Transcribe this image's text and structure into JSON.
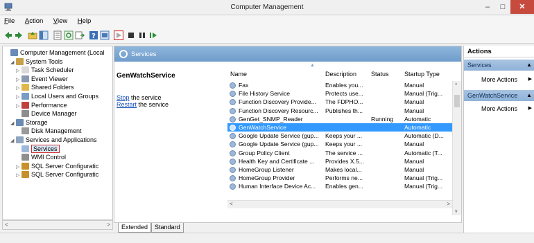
{
  "window": {
    "title": "Computer Management",
    "min": "–",
    "max": "□",
    "close": "✕"
  },
  "menu": [
    "File",
    "Action",
    "View",
    "Help"
  ],
  "tree": {
    "items": [
      {
        "label": "Computer Management (Local",
        "depth": 0,
        "arrow": "",
        "icon": "#6a8bb5"
      },
      {
        "label": "System Tools",
        "depth": 1,
        "arrow": "◢",
        "icon": "#c8a04a"
      },
      {
        "label": "Task Scheduler",
        "depth": 2,
        "arrow": "▷",
        "icon": "#d9d9d9"
      },
      {
        "label": "Event Viewer",
        "depth": 2,
        "arrow": "▷",
        "icon": "#8a9bb0"
      },
      {
        "label": "Shared Folders",
        "depth": 2,
        "arrow": "▷",
        "icon": "#e0b84a"
      },
      {
        "label": "Local Users and Groups",
        "depth": 2,
        "arrow": "▷",
        "icon": "#7a9cc4"
      },
      {
        "label": "Performance",
        "depth": 2,
        "arrow": "▷",
        "icon": "#c04040"
      },
      {
        "label": "Device Manager",
        "depth": 2,
        "arrow": "",
        "icon": "#8e8e8e"
      },
      {
        "label": "Storage",
        "depth": 1,
        "arrow": "◢",
        "icon": "#6a8bb5"
      },
      {
        "label": "Disk Management",
        "depth": 2,
        "arrow": "",
        "icon": "#9a9a9a"
      },
      {
        "label": "Services and Applications",
        "depth": 1,
        "arrow": "◢",
        "icon": "#8fa6c0"
      },
      {
        "label": "Services",
        "depth": 2,
        "arrow": "",
        "icon": "#9cb9d9",
        "highlight": true
      },
      {
        "label": "WMI Control",
        "depth": 2,
        "arrow": "",
        "icon": "#8e8e8e"
      },
      {
        "label": "SQL Server Configuratic",
        "depth": 2,
        "arrow": "▷",
        "icon": "#c8902a"
      },
      {
        "label": "SQL Server Configuratic",
        "depth": 2,
        "arrow": "▷",
        "icon": "#c8902a"
      }
    ]
  },
  "center": {
    "header": "Services",
    "selected_service": "GenWatchService",
    "stop_link": "Stop",
    "stop_rest": " the service",
    "restart_link": "Restart",
    "restart_rest": " the service",
    "columns": [
      "Name",
      "Description",
      "Status",
      "Startup Type"
    ],
    "rows": [
      {
        "name": "Fax",
        "desc": "Enables you...",
        "status": "",
        "type": "Manual"
      },
      {
        "name": "File History Service",
        "desc": "Protects use...",
        "status": "",
        "type": "Manual (Trig..."
      },
      {
        "name": "Function Discovery Provide...",
        "desc": "The FDPHO...",
        "status": "",
        "type": "Manual"
      },
      {
        "name": "Function Discovery Resourc...",
        "desc": "Publishes th...",
        "status": "",
        "type": "Manual"
      },
      {
        "name": "GenGet_SNMP_Reader",
        "desc": "",
        "status": "Running",
        "type": "Automatic"
      },
      {
        "name": "GenWatchService",
        "desc": "",
        "status": "",
        "type": "Automatic",
        "selected": true
      },
      {
        "name": "Google Update Service (gup...",
        "desc": "Keeps your ...",
        "status": "",
        "type": "Automatic (D..."
      },
      {
        "name": "Google Update Service (gup...",
        "desc": "Keeps your ...",
        "status": "",
        "type": "Manual"
      },
      {
        "name": "Group Policy Client",
        "desc": "The service ...",
        "status": "",
        "type": "Automatic (T..."
      },
      {
        "name": "Health Key and Certificate ...",
        "desc": "Provides X.5...",
        "status": "",
        "type": "Manual"
      },
      {
        "name": "HomeGroup Listener",
        "desc": "Makes local...",
        "status": "",
        "type": "Manual"
      },
      {
        "name": "HomeGroup Provider",
        "desc": "Performs ne...",
        "status": "",
        "type": "Manual (Trig..."
      },
      {
        "name": "Human Interface Device Ac...",
        "desc": "Enables gen...",
        "status": "",
        "type": "Manual (Trig..."
      }
    ],
    "tabs": [
      "Extended",
      "Standard"
    ]
  },
  "actions": {
    "title": "Actions",
    "groups": [
      {
        "label": "Services",
        "items": [
          "More Actions"
        ]
      },
      {
        "label": "GenWatchService",
        "items": [
          "More Actions"
        ]
      }
    ]
  }
}
